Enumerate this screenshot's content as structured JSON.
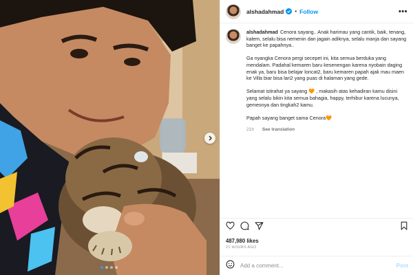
{
  "post": {
    "username": "alshadahmad",
    "follow_label": "Follow",
    "separator": "•",
    "more_label": "•••",
    "carousel": {
      "slides": 4,
      "active_index": 0
    }
  },
  "caption": {
    "username": "alshadahmad",
    "paragraphs": [
      "Cenora sayang.. Anak harimau yang cantik, baik, tenang, kalem, selalu bisa nemenin dan jagain adiknya, selalu manja dan sayang banget ke papahnya..",
      "Ga nyangka Cenora pergi secepet ini, kita semua berduka yang mendalam. Padahal kemaren baru kesenengan karena nyobain daging enak ya, baru bisa belajar loncat2, baru kemaren papah ajak mau maen ke Villa biar bisa lari2 yang puas di halaman yang gede.",
      "Selamat istirahat ya sayang 🧡 , makasih atas kehadiran kamu disini yang selalu bikin kita semua bahagia, happy, terhibur karena lucunya, gemesnya dan tingkah2 kamu.",
      "Papah sayang banget sama Cenora🧡"
    ],
    "time": "21h",
    "translate_label": "See translation"
  },
  "stats": {
    "likes": "487,980 likes",
    "time_ago": "21 HOURS AGO"
  },
  "comment": {
    "placeholder": "Add a comment...",
    "post_label": "Post"
  },
  "icons": {
    "like": "heart-icon",
    "comment": "comment-icon",
    "share": "share-icon",
    "save": "bookmark-icon",
    "emoji": "emoji-icon",
    "verified": "verified-badge-icon",
    "next": "chevron-right-icon"
  },
  "colors": {
    "accent": "#0095f6",
    "verified": "#0095f6",
    "active_dot": "#3897f0",
    "post_disabled": "#b3dbff"
  }
}
